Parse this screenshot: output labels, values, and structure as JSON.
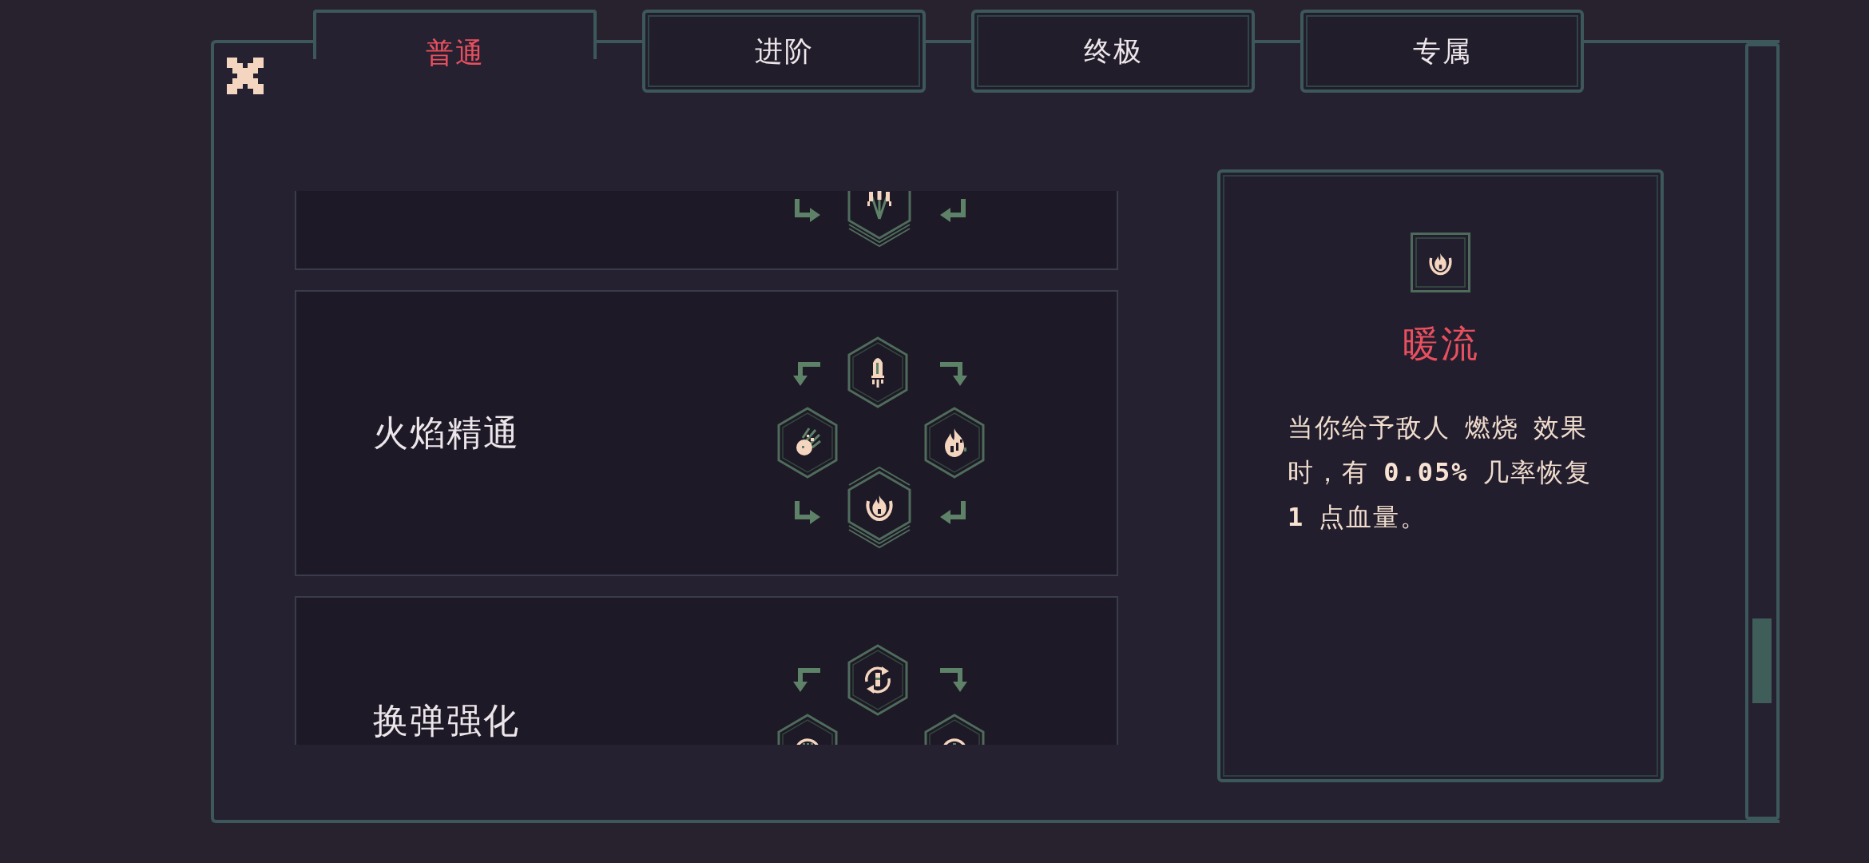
{
  "tabs": [
    {
      "label": "普通",
      "selected": true
    },
    {
      "label": "进阶",
      "selected": false
    },
    {
      "label": "终极",
      "selected": false
    },
    {
      "label": "专属",
      "selected": false
    }
  ],
  "skill_groups": [
    {
      "title": "火焰精通"
    },
    {
      "title": "换弹强化"
    }
  ],
  "detail": {
    "title": "暖流",
    "description": "当你给予敌人 燃烧 效果时，有 **0.05%** 几率恢复 **1** 点血量。"
  }
}
